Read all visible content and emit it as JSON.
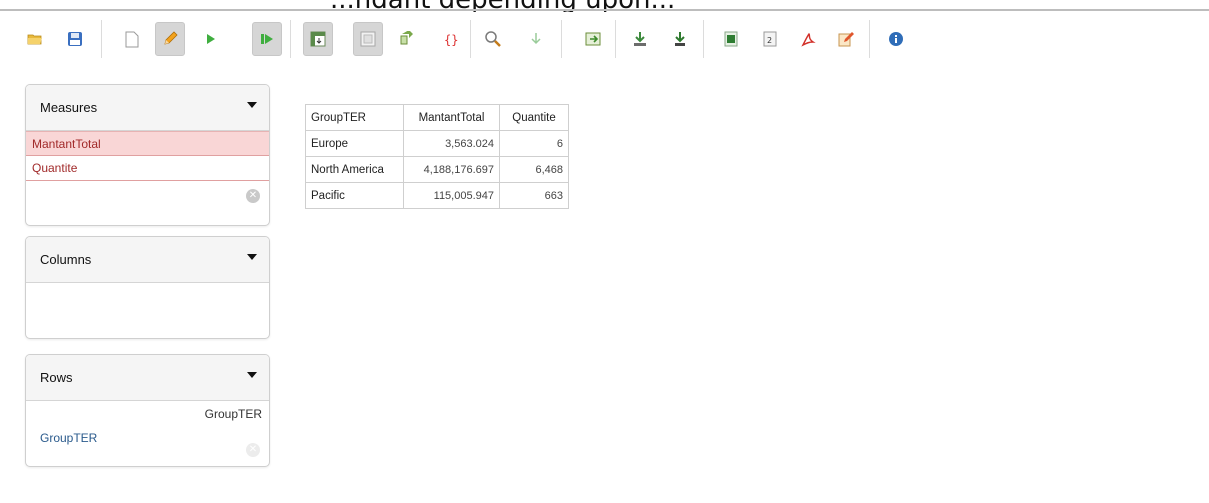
{
  "header_fragment": "...ndant depending upon...",
  "toolbar": {
    "buttons": [
      {
        "name": "open-folder-icon"
      },
      {
        "name": "save-icon"
      },
      {
        "name": "new-document-icon"
      },
      {
        "name": "edit-pencil-icon",
        "pressed": true
      },
      {
        "name": "run-play-icon"
      },
      {
        "name": "run-step-icon",
        "pressed": true
      },
      {
        "name": "pivot-table-icon",
        "pressed": true
      },
      {
        "name": "grid-icon",
        "pressed": true
      },
      {
        "name": "swap-axes-icon"
      },
      {
        "name": "json-braces-icon"
      },
      {
        "name": "zoom-icon"
      },
      {
        "name": "drill-down-icon"
      },
      {
        "name": "export-table-icon"
      },
      {
        "name": "download-icon"
      },
      {
        "name": "download-alt-icon"
      },
      {
        "name": "excel-icon"
      },
      {
        "name": "csv-icon"
      },
      {
        "name": "pdf-icon"
      },
      {
        "name": "edit-document-icon"
      },
      {
        "name": "info-icon"
      }
    ]
  },
  "measures": {
    "title": "Measures",
    "items": [
      "MantantTotal",
      "Quantite"
    ]
  },
  "columns": {
    "title": "Columns"
  },
  "rows": {
    "title": "Rows",
    "header_label": "GroupTER",
    "item": "GroupTER"
  },
  "pivot": {
    "headers": [
      "GroupTER",
      "MantantTotal",
      "Quantite"
    ],
    "rows": [
      [
        "Europe",
        "3,563.024",
        "6"
      ],
      [
        "North America",
        "4,188,176.697",
        "6,468"
      ],
      [
        "Pacific",
        "115,005.947",
        "663"
      ]
    ]
  }
}
